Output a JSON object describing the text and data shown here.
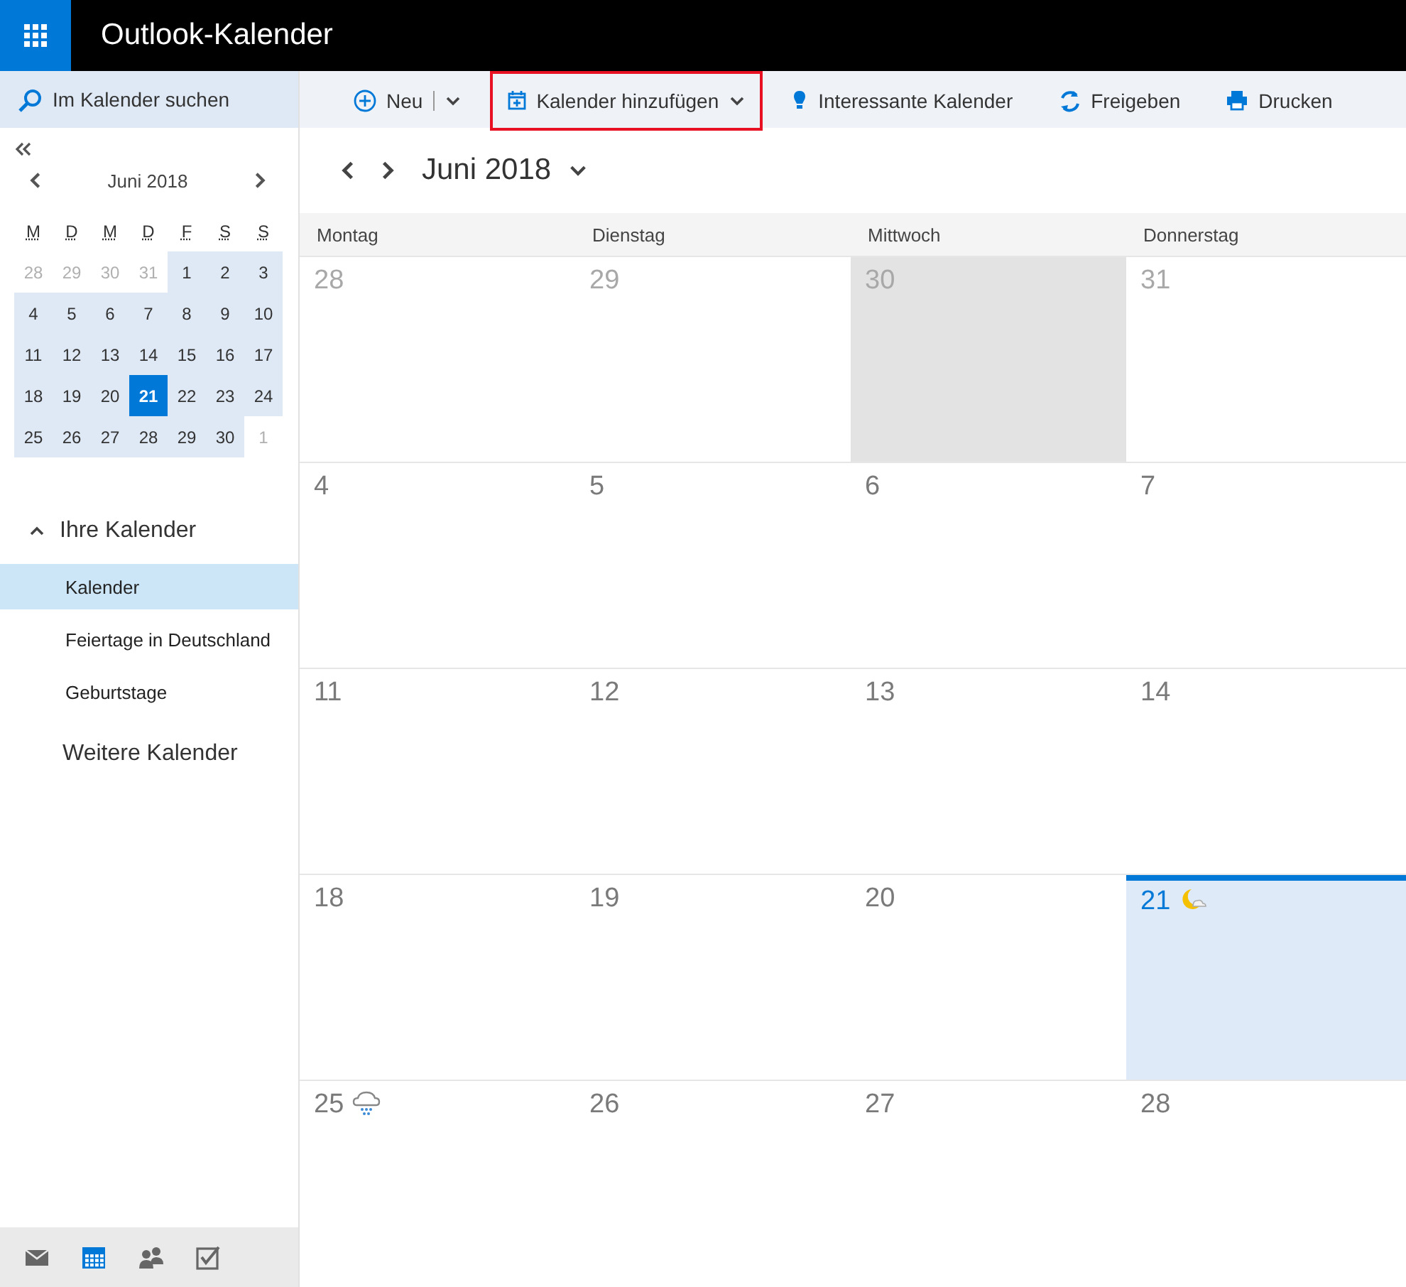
{
  "app_bar": {
    "title": "Outlook-Kalender"
  },
  "search": {
    "placeholder": "Im Kalender suchen"
  },
  "mini_calendar": {
    "title": "Juni 2018",
    "weekdays": [
      "M",
      "D",
      "M",
      "D",
      "F",
      "S",
      "S"
    ],
    "days": [
      {
        "label": "28",
        "in_month": false,
        "selected": false
      },
      {
        "label": "29",
        "in_month": false,
        "selected": false
      },
      {
        "label": "30",
        "in_month": false,
        "selected": false
      },
      {
        "label": "31",
        "in_month": false,
        "selected": false
      },
      {
        "label": "1",
        "in_month": true,
        "selected": false
      },
      {
        "label": "2",
        "in_month": true,
        "selected": false
      },
      {
        "label": "3",
        "in_month": true,
        "selected": false
      },
      {
        "label": "4",
        "in_month": true,
        "selected": false
      },
      {
        "label": "5",
        "in_month": true,
        "selected": false
      },
      {
        "label": "6",
        "in_month": true,
        "selected": false
      },
      {
        "label": "7",
        "in_month": true,
        "selected": false
      },
      {
        "label": "8",
        "in_month": true,
        "selected": false
      },
      {
        "label": "9",
        "in_month": true,
        "selected": false
      },
      {
        "label": "10",
        "in_month": true,
        "selected": false
      },
      {
        "label": "11",
        "in_month": true,
        "selected": false
      },
      {
        "label": "12",
        "in_month": true,
        "selected": false
      },
      {
        "label": "13",
        "in_month": true,
        "selected": false
      },
      {
        "label": "14",
        "in_month": true,
        "selected": false
      },
      {
        "label": "15",
        "in_month": true,
        "selected": false
      },
      {
        "label": "16",
        "in_month": true,
        "selected": false
      },
      {
        "label": "17",
        "in_month": true,
        "selected": false
      },
      {
        "label": "18",
        "in_month": true,
        "selected": false
      },
      {
        "label": "19",
        "in_month": true,
        "selected": false
      },
      {
        "label": "20",
        "in_month": true,
        "selected": false
      },
      {
        "label": "21",
        "in_month": true,
        "selected": true
      },
      {
        "label": "22",
        "in_month": true,
        "selected": false
      },
      {
        "label": "23",
        "in_month": true,
        "selected": false
      },
      {
        "label": "24",
        "in_month": true,
        "selected": false
      },
      {
        "label": "25",
        "in_month": true,
        "selected": false
      },
      {
        "label": "26",
        "in_month": true,
        "selected": false
      },
      {
        "label": "27",
        "in_month": true,
        "selected": false
      },
      {
        "label": "28",
        "in_month": true,
        "selected": false
      },
      {
        "label": "29",
        "in_month": true,
        "selected": false
      },
      {
        "label": "30",
        "in_month": true,
        "selected": false
      },
      {
        "label": "1",
        "in_month": false,
        "selected": false
      }
    ]
  },
  "your_calendars": {
    "label": "Ihre Kalender",
    "expanded": true,
    "items": [
      {
        "label": "Kalender",
        "selected": true
      },
      {
        "label": "Feiertage in Deutschland",
        "selected": false
      },
      {
        "label": "Geburtstage",
        "selected": false
      }
    ]
  },
  "more_calendars": {
    "label": "Weitere Kalender"
  },
  "bottom_nav": [
    {
      "kind": "mail",
      "selected": false
    },
    {
      "kind": "calendar",
      "selected": true
    },
    {
      "kind": "people",
      "selected": false
    },
    {
      "kind": "tasks",
      "selected": false
    }
  ],
  "toolbar": [
    {
      "kind": "new",
      "label": "Neu",
      "highlighted": false
    },
    {
      "kind": "add-calendar",
      "label": "Kalender hinzufügen",
      "highlighted": true
    },
    {
      "kind": "interesting",
      "label": "Interessante Kalender",
      "highlighted": false
    },
    {
      "kind": "share",
      "label": "Freigeben",
      "highlighted": false
    },
    {
      "kind": "print",
      "label": "Drucken",
      "highlighted": false
    }
  ],
  "month_nav": {
    "title": "Juni 2018"
  },
  "month_grid": {
    "columns": [
      "Montag",
      "Dienstag",
      "Mittwoch",
      "Donnerstag"
    ],
    "weeks": [
      [
        {
          "label": "28",
          "in_month": false,
          "shaded": false,
          "today": false
        },
        {
          "label": "29",
          "in_month": false,
          "shaded": false,
          "today": false
        },
        {
          "label": "30",
          "in_month": false,
          "shaded": true,
          "today": false
        },
        {
          "label": "31",
          "in_month": false,
          "shaded": false,
          "today": false
        }
      ],
      [
        {
          "label": "4",
          "in_month": true,
          "shaded": false,
          "today": false
        },
        {
          "label": "5",
          "in_month": true,
          "shaded": false,
          "today": false
        },
        {
          "label": "6",
          "in_month": true,
          "shaded": false,
          "today": false
        },
        {
          "label": "7",
          "in_month": true,
          "shaded": false,
          "today": false
        }
      ],
      [
        {
          "label": "11",
          "in_month": true,
          "shaded": false,
          "today": false
        },
        {
          "label": "12",
          "in_month": true,
          "shaded": false,
          "today": false
        },
        {
          "label": "13",
          "in_month": true,
          "shaded": false,
          "today": false
        },
        {
          "label": "14",
          "in_month": true,
          "shaded": false,
          "today": false
        }
      ],
      [
        {
          "label": "18",
          "in_month": true,
          "shaded": false,
          "today": false
        },
        {
          "label": "19",
          "in_month": true,
          "shaded": false,
          "today": false
        },
        {
          "label": "20",
          "in_month": true,
          "shaded": false,
          "today": false
        },
        {
          "label": "21",
          "in_month": true,
          "shaded": false,
          "today": true,
          "weather": {
            "kind": "moon-cloud"
          }
        }
      ],
      [
        {
          "label": "25",
          "in_month": true,
          "shaded": false,
          "today": false,
          "weather": {
            "kind": "rain"
          }
        },
        {
          "label": "26",
          "in_month": true,
          "shaded": false,
          "today": false
        },
        {
          "label": "27",
          "in_month": true,
          "shaded": false,
          "today": false
        },
        {
          "label": "28",
          "in_month": true,
          "shaded": false,
          "today": false
        }
      ]
    ]
  }
}
